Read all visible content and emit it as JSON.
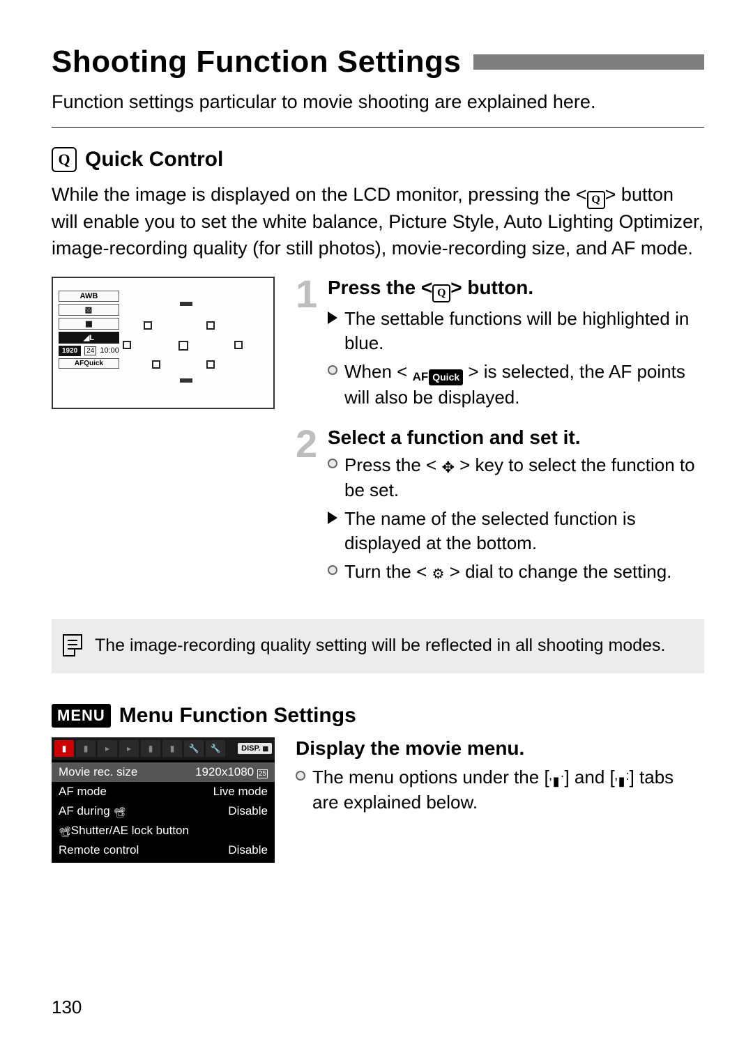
{
  "title": "Shooting Function Settings",
  "intro": "Function settings particular to movie shooting are explained here.",
  "quick_control": {
    "heading": "Quick Control",
    "q_label": "Q",
    "body_before": "While the image is displayed on the LCD monitor, pressing the <",
    "body_after": "> button will enable you to set the white balance, Picture Style, Auto Lighting Optimizer, image-recording quality (for still photos), movie-recording size, and AF mode.",
    "lcd": {
      "awb": "AWB",
      "pstyle": "▧",
      "alo": "▦",
      "quality": "◢L",
      "rec_size": "1920",
      "fps": "24",
      "time": "10:00",
      "af_mode": "AFQuick"
    },
    "steps": [
      {
        "num": "1",
        "head_before": "Press the <",
        "head_after": "> button.",
        "items": [
          {
            "marker": "tri",
            "text": "The settable functions will be highlighted in blue."
          },
          {
            "marker": "disc",
            "before": "When < ",
            "af_label": "AF",
            "quick_label": "Quick",
            "after": " > is selected, the AF points will also be displayed."
          }
        ]
      },
      {
        "num": "2",
        "head": "Select a function and set it.",
        "items": [
          {
            "marker": "disc",
            "before": "Press the < ",
            "icon": "cross",
            "after": " > key to select the function to be set."
          },
          {
            "marker": "tri",
            "text": "The name of the selected function is displayed at the bottom."
          },
          {
            "marker": "disc",
            "before": "Turn the < ",
            "icon": "dial",
            "after": " > dial to change the setting."
          }
        ]
      }
    ]
  },
  "note": "The image-recording quality setting will be reflected in all shooting modes.",
  "menu_section": {
    "badge": "MENU",
    "heading": "Menu Function Settings",
    "display_heading": "Display the movie menu.",
    "text_before": "The menu options under the [",
    "text_mid": "] and [",
    "text_after": "] tabs are explained below.",
    "disp_label": "DISP.",
    "menu": {
      "rows": [
        {
          "label": "Movie rec. size",
          "value": "1920x1080",
          "selected": true,
          "fps": "25"
        },
        {
          "label": "AF mode",
          "value": "Live mode"
        },
        {
          "label": "AF during ",
          "value": "Disable",
          "movie_icon": true
        },
        {
          "label": "Shutter/AE lock button",
          "value": "",
          "movie_icon_prefix": true
        },
        {
          "label": "Remote control",
          "value": "Disable"
        }
      ]
    }
  },
  "page_number": "130"
}
